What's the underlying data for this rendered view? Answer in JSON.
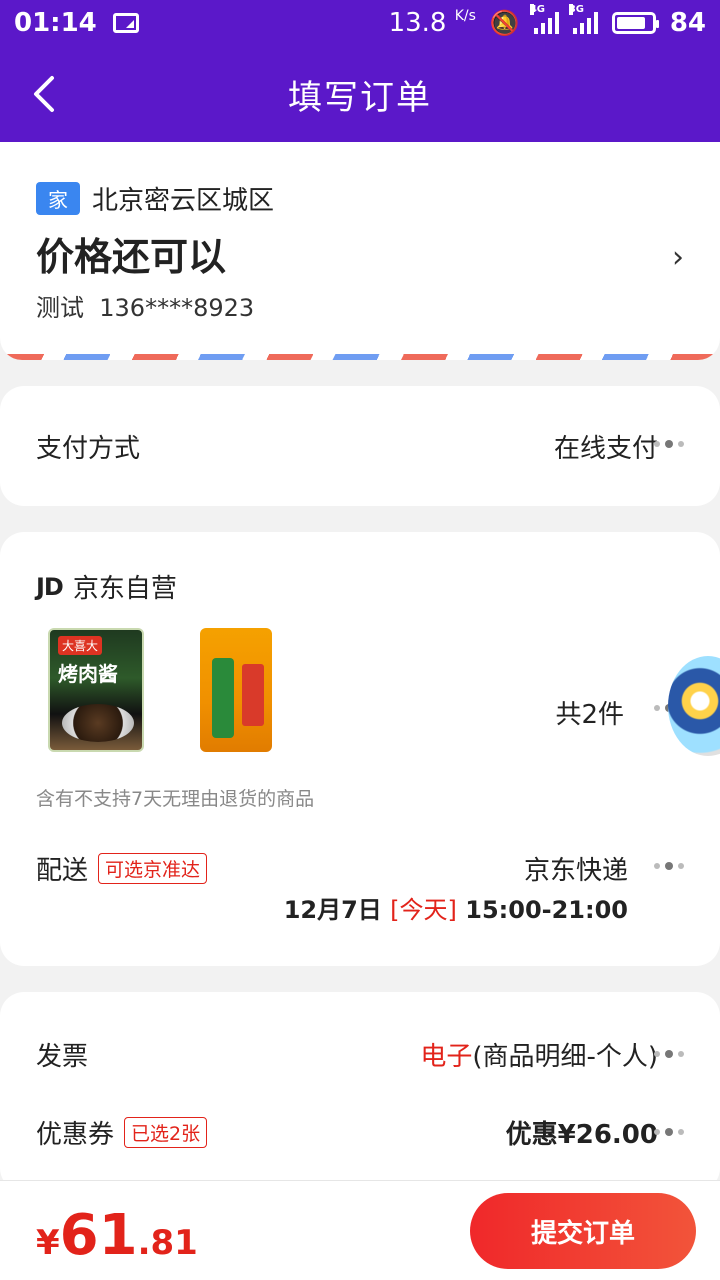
{
  "status_bar": {
    "time": "01:14",
    "speed": "13.8",
    "speed_unit": "K/s",
    "net1": "4G",
    "net2": "3G",
    "battery": "84"
  },
  "nav": {
    "title": "填写订单"
  },
  "address": {
    "tag": "家",
    "region": "北京密云区城区",
    "detail": "价格还可以",
    "contact": "测试  136****8923"
  },
  "payment": {
    "label": "支付方式",
    "value": "在线支付"
  },
  "store": {
    "name": "京东自营",
    "products": [
      {
        "icon": "sauce-product-image"
      },
      {
        "icon": "rice-product-image"
      }
    ],
    "count": "共2件",
    "notice": "含有不支持7天无理由退货的商品"
  },
  "delivery": {
    "label": "配送",
    "tag": "可选京准达",
    "carrier": "京东快递",
    "date": "12月7日",
    "today": "[今天]",
    "time": "15:00-21:00"
  },
  "invoice": {
    "label": "发票",
    "value_red": "电子",
    "value": "(商品明细-个人)"
  },
  "coupon": {
    "label": "优惠券",
    "tag": "已选2张",
    "value": "优惠¥26.00"
  },
  "footer": {
    "currency": "¥",
    "price_int": "61",
    "price_dec": ".81",
    "submit": "提交订单"
  },
  "colors": {
    "brand": "#5b18c9",
    "accent": "#e2231a"
  }
}
